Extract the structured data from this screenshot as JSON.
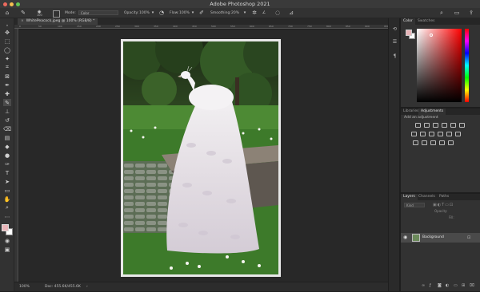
{
  "app": {
    "window_title": "Adobe Photoshop 2021"
  },
  "options_bar": {
    "mode_label": "Mode:",
    "mode_value": "Color",
    "opacity_label": "Opacity:",
    "opacity_value": "100%",
    "flow_label": "Flow:",
    "flow_value": "100%",
    "smoothing_label": "Smoothing:",
    "smoothing_value": "20%",
    "brush_size": "100"
  },
  "document": {
    "tab_label": "WhitePeacock.jpeg @ 100% (RGB/8) *",
    "close_glyph": "×"
  },
  "rulers": {
    "horizontal_ticks": [
      "0",
      "50",
      "100",
      "150",
      "200",
      "250",
      "300",
      "350",
      "400",
      "450",
      "500",
      "550",
      "600",
      "650",
      "700",
      "750",
      "800",
      "850",
      "900",
      "950"
    ]
  },
  "status_bar": {
    "zoom": "100%",
    "doc_info": "Doc: 455.6K/455.6K",
    "arrow": "›"
  },
  "panels": {
    "color": {
      "tabs": [
        "Color",
        "Swatches"
      ]
    },
    "adjustments": {
      "tabs": [
        "Libraries",
        "Adjustments"
      ],
      "hint": "Add an adjustment"
    },
    "layers": {
      "tabs": [
        "Layers",
        "Channels",
        "Paths"
      ],
      "layer_name": "Background",
      "kind_label": "Kind",
      "opacity_label": "Opacity:",
      "fill_label": "Fill:",
      "bottom_icons": [
        "link-icon",
        "fx-icon",
        "mask-icon",
        "adjustment-layer-icon",
        "group-icon",
        "new-layer-icon",
        "trash-icon"
      ]
    }
  },
  "colors": {
    "foreground": "#e8b4b8",
    "background": "#ffffff",
    "picker_hue": "#ff0000",
    "accent": "#2d8ceb"
  }
}
